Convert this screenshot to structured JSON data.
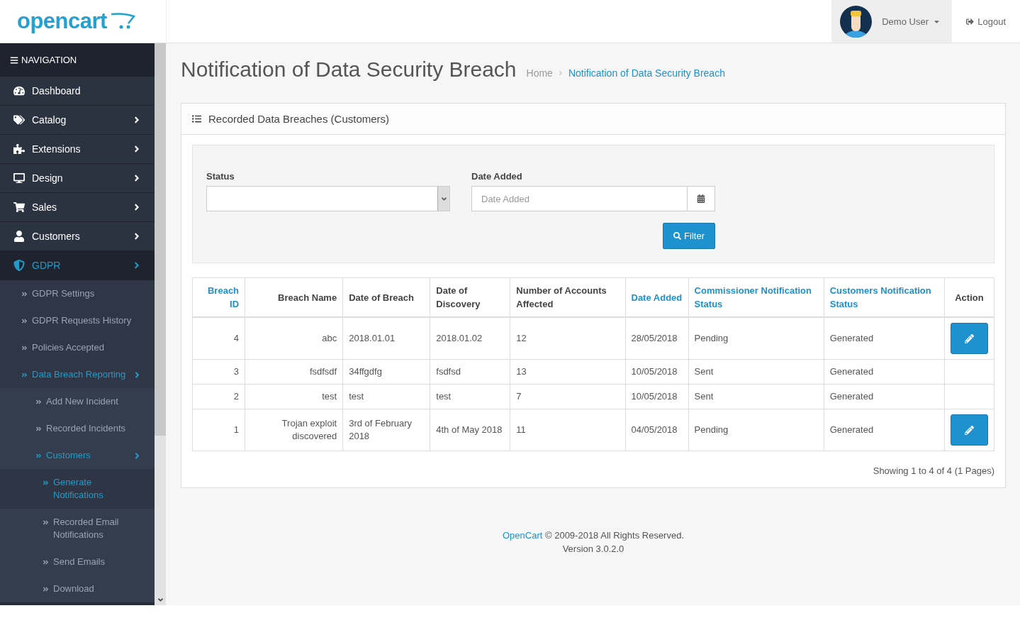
{
  "header": {
    "logo": "opencart",
    "user": "Demo User",
    "logout": "Logout"
  },
  "navigation": {
    "title": "NAVIGATION",
    "items": [
      {
        "label": "Dashboard",
        "has_submenu": false,
        "selected": false
      },
      {
        "label": "Catalog",
        "has_submenu": true,
        "selected": false
      },
      {
        "label": "Extensions",
        "has_submenu": true,
        "selected": false
      },
      {
        "label": "Design",
        "has_submenu": true,
        "selected": false
      },
      {
        "label": "Sales",
        "has_submenu": true,
        "selected": false
      },
      {
        "label": "Customers",
        "has_submenu": true,
        "selected": false
      },
      {
        "label": "GDPR",
        "has_submenu": true,
        "selected": true,
        "children": [
          {
            "label": "GDPR Settings",
            "has_submenu": false,
            "selected": false
          },
          {
            "label": "GDPR Requests History",
            "has_submenu": false,
            "selected": false
          },
          {
            "label": "Policies Accepted",
            "has_submenu": false,
            "selected": false
          },
          {
            "label": "Data Breach Reporting",
            "has_submenu": true,
            "selected": true,
            "children": [
              {
                "label": "Add New Incident",
                "has_submenu": false,
                "selected": false
              },
              {
                "label": "Recorded Incidents",
                "has_submenu": false,
                "selected": false
              },
              {
                "label": "Customers",
                "has_submenu": true,
                "selected": true,
                "children": [
                  {
                    "label": "Generate Notifications",
                    "has_submenu": false,
                    "selected": true
                  },
                  {
                    "label": "Recorded Email Notifications",
                    "has_submenu": false,
                    "selected": false
                  },
                  {
                    "label": "Send Emails",
                    "has_submenu": false,
                    "selected": false
                  },
                  {
                    "label": "Download",
                    "has_submenu": false,
                    "selected": false
                  }
                ]
              }
            ]
          }
        ]
      }
    ]
  },
  "page": {
    "title": "Notification of Data Security Breach",
    "breadcrumb": [
      {
        "label": "Home",
        "selected": false
      },
      {
        "label": "Notification of Data Security Breach",
        "selected": true
      }
    ]
  },
  "panel": {
    "title": "Recorded Data Breaches (Customers)",
    "filter": {
      "status_label": "Status",
      "date_label": "Date Added",
      "date_placeholder": "Date Added",
      "button": "Filter"
    },
    "table": {
      "columns": [
        {
          "label": "Breach ID",
          "sortable": true
        },
        {
          "label": "Breach Name",
          "sortable": false
        },
        {
          "label": "Date of Breach",
          "sortable": false
        },
        {
          "label": "Date of Discovery",
          "sortable": false
        },
        {
          "label": "Number of Accounts Affected",
          "sortable": false
        },
        {
          "label": "Date Added",
          "sortable": true
        },
        {
          "label": "Commissioner Notification Status",
          "sortable": true
        },
        {
          "label": "Customers Notification Status",
          "sortable": true
        },
        {
          "label": "Action",
          "sortable": false
        }
      ],
      "rows": [
        {
          "cells": [
            "4",
            "abc",
            "2018.01.01",
            "2018.01.02",
            "12",
            "28/05/2018",
            "Pending",
            "Generated"
          ],
          "editable": true
        },
        {
          "cells": [
            "3",
            "fsdfsdf",
            "34ffgdfg",
            "fsdfsd",
            "13",
            "10/05/2018",
            "Sent",
            "Generated"
          ],
          "editable": false
        },
        {
          "cells": [
            "2",
            "test",
            "test",
            "test",
            "7",
            "10/05/2018",
            "Sent",
            "Generated"
          ],
          "editable": false
        },
        {
          "cells": [
            "1",
            "Trojan exploit discovered",
            "3rd of February 2018",
            "4th of May 2018",
            "11",
            "04/05/2018",
            "Pending",
            "Generated"
          ],
          "editable": true
        }
      ]
    },
    "pagination": "Showing 1 to 4 of 4 (1 Pages)"
  },
  "footer": {
    "link": "OpenCart",
    "text": "© 2009-2018 All Rights Reserved.",
    "version": "Version 3.0.2.0"
  }
}
